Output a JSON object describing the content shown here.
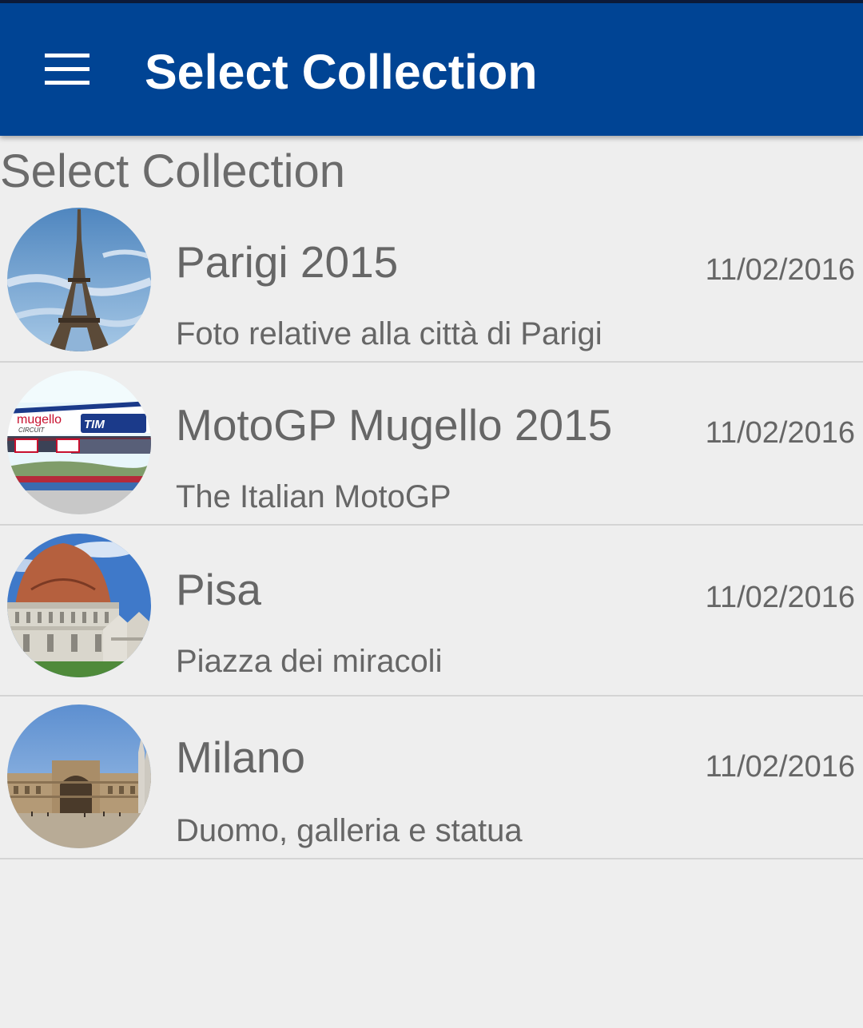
{
  "app_bar": {
    "title": "Select Collection",
    "menu_icon": "hamburger-menu-icon"
  },
  "section": {
    "title": "Select Collection"
  },
  "collections": [
    {
      "title": "Parigi 2015",
      "date": "11/02/2016",
      "description": "Foto relative alla città di Parigi",
      "thumbnail": "eiffel-tower-photo"
    },
    {
      "title": "MotoGP Mugello 2015",
      "date": "11/02/2016",
      "description": "The Italian MotoGP",
      "thumbnail": "mugello-circuit-photo",
      "thumbnail_text": [
        "mugello",
        "CIRCUIT",
        "TIM"
      ]
    },
    {
      "title": "Pisa",
      "date": "11/02/2016",
      "description": "Piazza dei miracoli",
      "thumbnail": "pisa-baptistery-photo"
    },
    {
      "title": "Milano",
      "date": "11/02/2016",
      "description": "Duomo, galleria e statua",
      "thumbnail": "milano-galleria-photo"
    }
  ],
  "colors": {
    "app_bar": "#004494",
    "background": "#eeeeee",
    "text": "#666666",
    "divider": "#d4d4d4"
  }
}
